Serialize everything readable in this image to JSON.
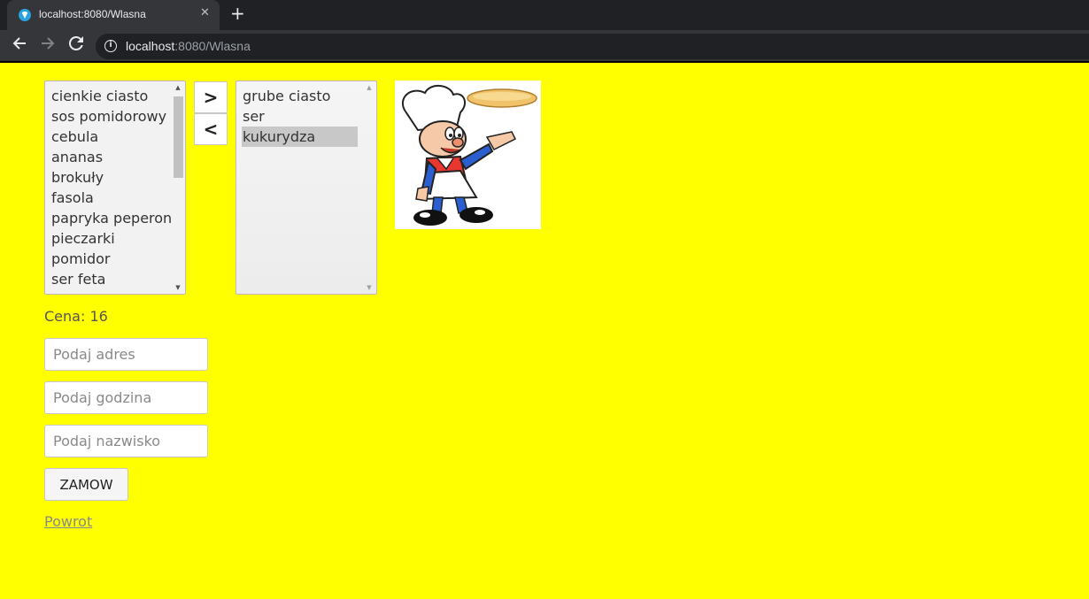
{
  "browser": {
    "tab_title": "localhost:8080/Wlasna",
    "close_glyph": "✕",
    "new_tab_glyph": "+",
    "url_host": "localhost",
    "url_path": ":8080/Wlasna",
    "icons": [
      "favicon-icon",
      "close-icon",
      "plus-icon",
      "back-arrow-icon",
      "forward-arrow-icon",
      "reload-icon",
      "info-icon"
    ]
  },
  "available_ingredients": {
    "items": [
      "cienkie ciasto",
      "sos pomidorowy",
      "cebula",
      "ananas",
      "brokuły",
      "fasola",
      "papryka peperoni",
      "pieczarki",
      "pomidor",
      "ser feta"
    ]
  },
  "selected_ingredients": {
    "items": [
      "grube ciasto",
      "ser",
      "kukurydza"
    ],
    "highlighted": "kukurydza"
  },
  "controls": {
    "add_glyph": ">",
    "remove_glyph": "<"
  },
  "order": {
    "price_label": "Cena: 16",
    "address_placeholder": "Podaj adres",
    "hour_placeholder": "Podaj godzina",
    "surname_placeholder": "Podaj nazwisko",
    "submit_label": "ZAMOW",
    "back_link": "Powrot"
  },
  "colors": {
    "page_background": "#ffff00"
  }
}
